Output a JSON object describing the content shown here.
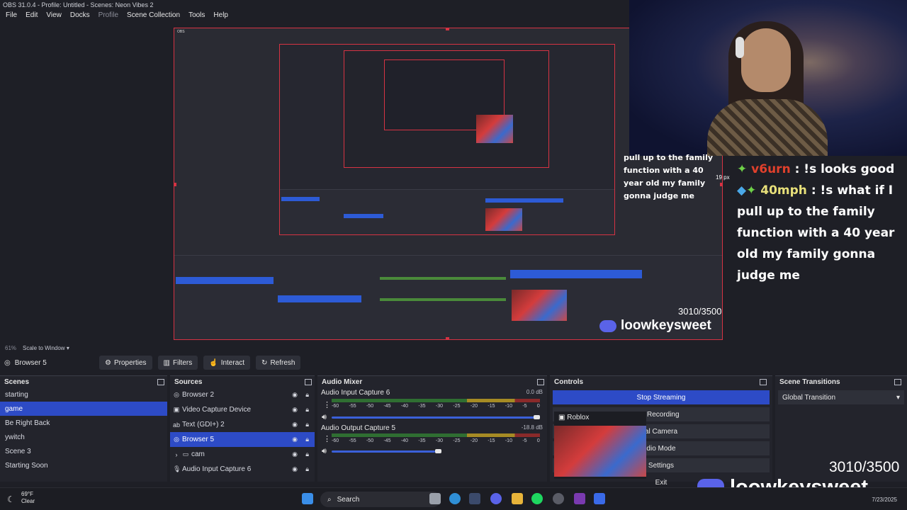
{
  "window": {
    "title": "OBS 31.0.4 - Profile: Untitled - Scenes: Neon Vibes 2"
  },
  "menu": [
    "File",
    "Edit",
    "View",
    "Docks",
    "Profile",
    "Scene Collection",
    "Tools",
    "Help"
  ],
  "preview": {
    "zoom": "61%",
    "scale_mode": "Scale to Window"
  },
  "source_toolbar": {
    "selected_source": "Browser 5",
    "properties": "Properties",
    "filters": "Filters",
    "interact": "Interact",
    "refresh": "Refresh"
  },
  "scenes": {
    "title": "Scenes",
    "items": [
      "starting",
      "game",
      "Be Right Back",
      "ywitch",
      "Scene 3",
      "Starting Soon"
    ],
    "selected_index": 1
  },
  "sources": {
    "title": "Sources",
    "items": [
      {
        "label": "Browser 2",
        "icon": "globe-icon"
      },
      {
        "label": "Video Capture Device",
        "icon": "camera-icon"
      },
      {
        "label": "Text (GDI+) 2",
        "icon": "text-icon"
      },
      {
        "label": "Browser 5",
        "icon": "globe-icon",
        "selected": true
      },
      {
        "label": "cam",
        "icon": "folder-icon",
        "group": true
      },
      {
        "label": "Audio Input Capture 6",
        "icon": "mic-icon"
      }
    ]
  },
  "mixer": {
    "title": "Audio Mixer",
    "channels": [
      {
        "name": "Audio Input Capture 6",
        "db": "0.0 dB",
        "volume_percent": 98
      },
      {
        "name": "Audio Output Capture 5",
        "db": "-18.8 dB",
        "volume_percent": 50
      }
    ],
    "ticks": [
      "-60",
      "-55",
      "-50",
      "-45",
      "-40",
      "-35",
      "-30",
      "-25",
      "-20",
      "-15",
      "-10",
      "-5",
      "0"
    ]
  },
  "controls": {
    "title": "Controls",
    "stop_streaming": "Stop Streaming",
    "recording": "t Recording",
    "virtual_camera": "al Camera",
    "studio_mode": "dio Mode",
    "settings": "Settings",
    "exit": "Exit",
    "preview_popup": "Roblox"
  },
  "transitions": {
    "title": "Scene Transitions",
    "selected": "Global Transition"
  },
  "taskbar": {
    "weather_temp": "69°F",
    "weather_desc": "Clear",
    "search_label": "Search",
    "date": "7/23/2025"
  },
  "overlay": {
    "chat": [
      {
        "user": "v6urn",
        "message": ": !s looks good"
      },
      {
        "user": "40mph",
        "message": ": !s what if I pull up to the family function with a 40 year old my family gonna judge me"
      }
    ],
    "inner_chat": "pull up to the family function with a 40 year old my family gonna judge me",
    "px_label": "19 px",
    "counter": "3010/3500",
    "brand": "loowkeysweet"
  },
  "colors": {
    "accent": "#2d4bc6",
    "selection_border": "#d63343",
    "chat_user1": "#e0402c",
    "chat_user2": "#e8e07a"
  }
}
